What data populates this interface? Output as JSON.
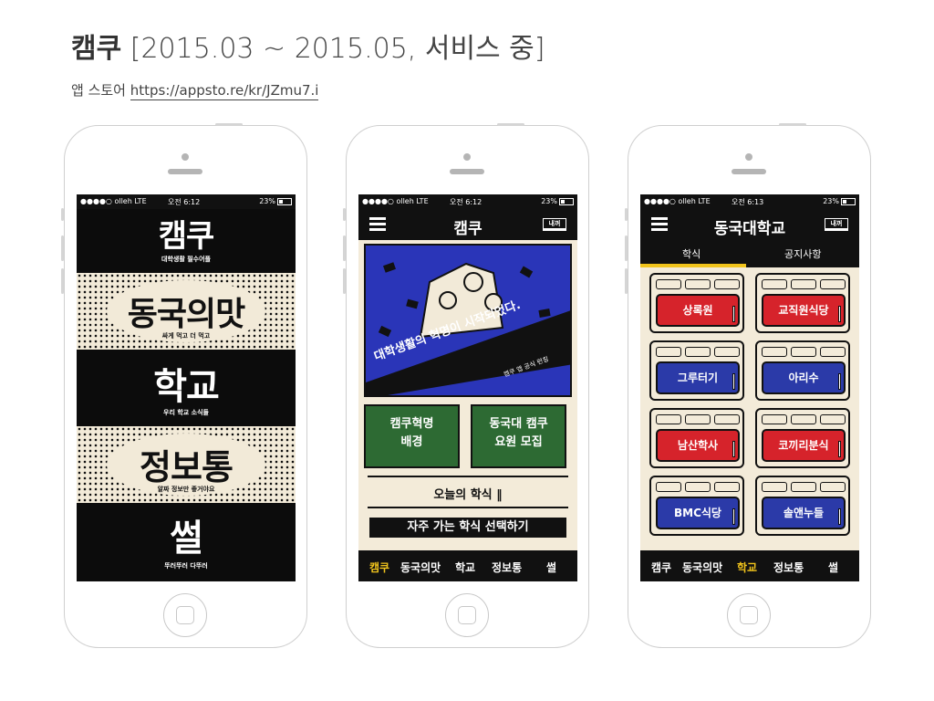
{
  "header": {
    "app_name": "캠쿠",
    "period": "[2015.03 ~ 2015.05, 서비스 중]",
    "store_label": "앱 스토어",
    "store_link": "https://appsto.re/kr/JZmu7.i"
  },
  "status": {
    "carrier": "●●●●○ olleh",
    "net": "LTE",
    "battery": "23%"
  },
  "screen1": {
    "time": "오전 6:12",
    "logo": "캠쿠",
    "logo_sub": "대학생활 필수어플",
    "menu": [
      {
        "label": "동국의맛",
        "sub": "싸게 먹고 더 먹고"
      },
      {
        "label": "학교",
        "sub": "우리 학교 소식들"
      },
      {
        "label": "정보통",
        "sub": "알짜 정보만 좋거야요"
      },
      {
        "label": "썰",
        "sub": "뚜러뚜러 다뚜러"
      }
    ]
  },
  "screen2": {
    "time": "오전 6:12",
    "title": "캠쿠",
    "badge": "내꺼",
    "poster_headline": "대학생활의 혁명이 시작되었다.",
    "poster_caption": "캠쿠 앱 공식 런칭",
    "card_left": [
      "캠쿠혁명",
      "배경"
    ],
    "card_right": [
      "동국대 캠쿠",
      "요원 모집"
    ],
    "todays_meal": "오늘의 학식",
    "fav_button": "자주 가는 학식 선택하기"
  },
  "screen3": {
    "time": "오전 6:13",
    "title": "동국대학교",
    "badge": "내꺼",
    "tabs": [
      "학식",
      "공지사항"
    ],
    "cafeterias": [
      {
        "name": "상록원",
        "color": "red"
      },
      {
        "name": "교직원식당",
        "color": "red"
      },
      {
        "name": "그루터기",
        "color": "blue"
      },
      {
        "name": "아리수",
        "color": "blue"
      },
      {
        "name": "남산학사",
        "color": "red"
      },
      {
        "name": "코끼리분식",
        "color": "red"
      },
      {
        "name": "BMC식당",
        "color": "blue"
      },
      {
        "name": "솔앤누들",
        "color": "blue"
      }
    ]
  },
  "tabbar": [
    "캠쿠",
    "동국의맛",
    "학교",
    "정보통",
    "썰"
  ],
  "colors": {
    "accent": "#f1c41c",
    "red": "#d6232b",
    "blue": "#2b3aa8",
    "green": "#2d6a33",
    "cream": "#f3ebd9"
  }
}
